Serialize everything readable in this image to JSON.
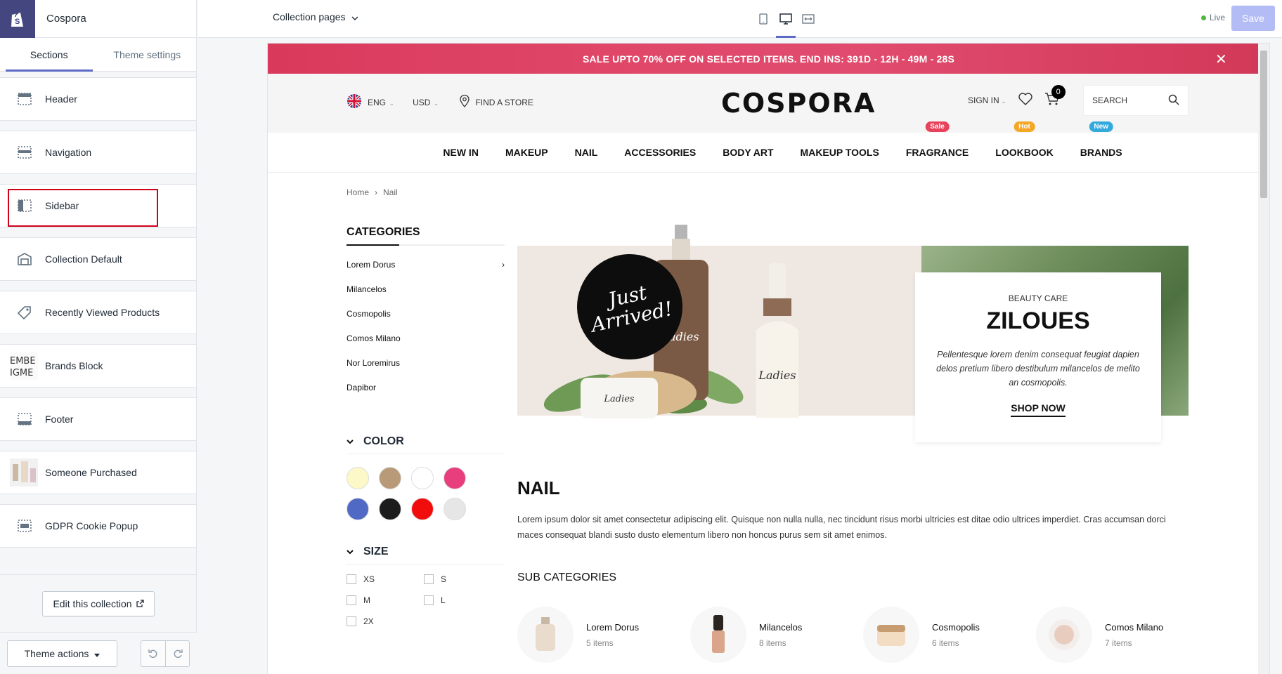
{
  "store_name": "Cospora",
  "tabs": [
    "Sections",
    "Theme settings"
  ],
  "sections": [
    {
      "label": "Header",
      "icon": "header-layout-icon"
    },
    {
      "label": "Navigation",
      "icon": "navigation-layout-icon"
    },
    {
      "label": "Sidebar",
      "icon": "sidebar-layout-icon"
    },
    {
      "label": "Collection Default",
      "icon": "collection-icon"
    },
    {
      "label": "Recently Viewed Products",
      "icon": "tag-icon"
    },
    {
      "label": "Brands Block",
      "icon": "brands-thumbnail-icon"
    },
    {
      "label": "Footer",
      "icon": "footer-layout-icon"
    },
    {
      "label": "Someone Purchased",
      "icon": "purchase-thumbnail-icon"
    },
    {
      "label": "GDPR Cookie Popup",
      "icon": "popup-layout-icon"
    }
  ],
  "brands_thumb_text": "EMBE\nIGME",
  "edit_collection_label": "Edit this collection",
  "theme_actions_label": "Theme actions",
  "page_selector": "Collection pages",
  "live_label": "Live",
  "save_label": "Save",
  "preview": {
    "promo_text": "SALE UPTO 70% OFF ON SELECTED ITEMS. END INS: 391D - 12H - 49M - 28S",
    "lang": "ENG",
    "currency": "USD",
    "find_store": "FIND A STORE",
    "logo": "COSPORA",
    "sign_in": "SIGN IN",
    "cart_count": "0",
    "search_placeholder": "SEARCH",
    "nav": [
      {
        "label": "NEW IN"
      },
      {
        "label": "MAKEUP"
      },
      {
        "label": "NAIL"
      },
      {
        "label": "ACCESSORIES"
      },
      {
        "label": "BODY ART"
      },
      {
        "label": "MAKEUP TOOLS"
      },
      {
        "label": "FRAGRANCE",
        "badge": "Sale",
        "badge_color": "#e8435c"
      },
      {
        "label": "LOOKBOOK",
        "badge": "Hot",
        "badge_color": "#f5a623"
      },
      {
        "label": "BRANDS",
        "badge": "New",
        "badge_color": "#34aadc"
      }
    ],
    "breadcrumb": [
      "Home",
      "Nail"
    ],
    "categories_title": "CATEGORIES",
    "categories": [
      "Lorem Dorus",
      "Milancelos",
      "Cosmopolis",
      "Comos Milano",
      "Nor Loremirus",
      "Dapibor"
    ],
    "color_title": "COLOR",
    "colors": [
      "#fdf8c7",
      "#b89a78",
      "#ffffff",
      "#e83e7d",
      "#5069c4",
      "#1c1c1c",
      "#f20d0d",
      "#e6e6e6"
    ],
    "size_title": "SIZE",
    "sizes": [
      "XS",
      "S",
      "M",
      "L",
      "2X"
    ],
    "banner": {
      "sticker_line1": "Just",
      "sticker_line2": "Arrived!",
      "kicker": "BEAUTY CARE",
      "title": "ZILOUES",
      "text": "Pellentesque lorem denim consequat feugiat dapien delos pretium libero destibulum milancelos de melito an cosmopolis.",
      "cta": "SHOP NOW",
      "bottle_label": "Ladies"
    },
    "page_title": "NAIL",
    "description": "Lorem ipsum dolor sit amet consectetur adipiscing elit. Quisque non nulla nulla, nec tincidunt risus morbi ultricies est ditae odio ultrices imperdiet. Cras accumsan dorci maces consequat blandi susto dusto elementum libero non honcus purus sem sit amet enimos.",
    "sub_categories_title": "SUB CATEGORIES",
    "sub_categories": [
      {
        "name": "Lorem Dorus",
        "count": "5 items"
      },
      {
        "name": "Milancelos",
        "count": "8 items"
      },
      {
        "name": "Cosmopolis",
        "count": "6 items"
      },
      {
        "name": "Comos Milano",
        "count": "7 items"
      }
    ]
  }
}
